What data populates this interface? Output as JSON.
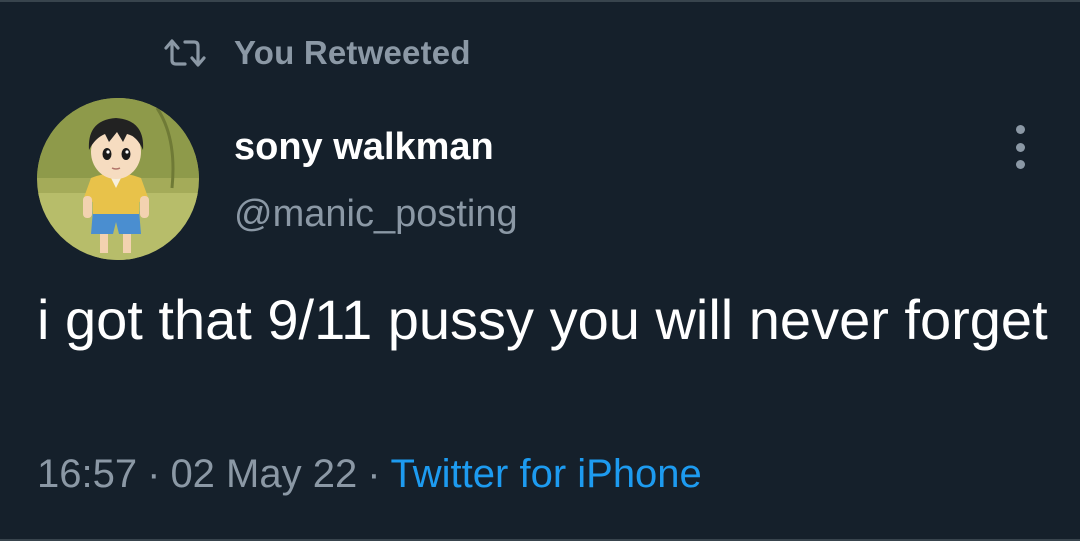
{
  "retweet": {
    "label": "You Retweeted",
    "icon": "retweet-icon"
  },
  "author": {
    "display_name": "sony walkman",
    "handle": "@manic_posting",
    "avatar": "avatar-anime-character"
  },
  "tweet": {
    "text": "i got that 9/11 pussy you will never forget",
    "time": "16:57",
    "date": "02 May 22",
    "separator": "·",
    "source": "Twitter for iPhone"
  },
  "menu": {
    "icon": "more-vertical-icon"
  },
  "colors": {
    "background": "#15202b",
    "primary_text": "#ffffff",
    "secondary_text": "#8b98a5",
    "link": "#1d9bf0",
    "divider": "#38444d"
  }
}
